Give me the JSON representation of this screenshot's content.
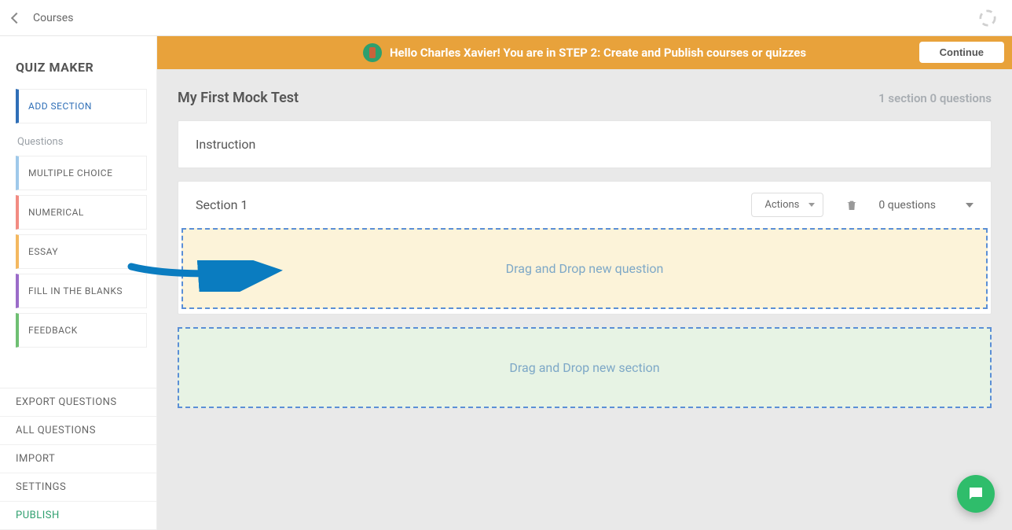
{
  "topbar": {
    "breadcrumb": "Courses"
  },
  "sidebar": {
    "title": "QUIZ MAKER",
    "addSection": "ADD SECTION",
    "questionsLabel": "Questions",
    "multipleChoice": "MULTIPLE CHOICE",
    "numerical": "NUMERICAL",
    "essay": "ESSAY",
    "fillInBlanks": "FILL IN THE BLANKS",
    "feedback": "FEEDBACK",
    "exportQuestions": "EXPORT QUESTIONS",
    "allQuestions": "ALL QUESTIONS",
    "import": "IMPORT",
    "settings": "SETTINGS",
    "publish": "PUBLISH"
  },
  "banner": {
    "text": "Hello Charles Xavier! You are in STEP 2: Create and Publish courses or quizzes",
    "continueLabel": "Continue"
  },
  "page": {
    "title": "My First Mock Test",
    "counts": "1 section 0 questions",
    "instruction": "Instruction"
  },
  "section": {
    "title": "Section 1",
    "actionsLabel": "Actions",
    "questionCount": "0 questions",
    "dropQuestion": "Drag and Drop new question"
  },
  "dropSection": "Drag and Drop new section"
}
